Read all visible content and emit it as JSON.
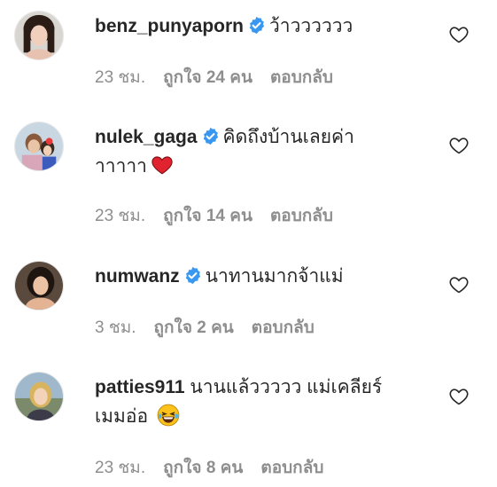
{
  "comments": [
    {
      "username": "benz_punyaporn",
      "verified": true,
      "text": "ว้าวววววว",
      "time": "23 ชม.",
      "likes": "ถูกใจ 24 คน",
      "reply": "ตอบกลับ"
    },
    {
      "username": "nulek_gaga",
      "verified": true,
      "text": "คิดถึงบ้านเลยค่าาาาาา",
      "text_line1": "คิดถึงบ้านเลยค่า",
      "text_line2": "าาาาา",
      "emoji": "red-heart-emoji",
      "time": "23 ชม.",
      "likes": "ถูกใจ 14 คน",
      "reply": "ตอบกลับ"
    },
    {
      "username": "numwanz",
      "verified": true,
      "text": "นาทานมากจ้าแม่",
      "time": "3 ชม.",
      "likes": "ถูกใจ 2 คน",
      "reply": "ตอบกลับ"
    },
    {
      "username": "patties911",
      "verified": false,
      "text_line1": "นานแล้ววววว แม่เคลียร์",
      "text_line2": "เมมอ่อ",
      "emoji": "laughing-tears-emoji",
      "time": "23 ชม.",
      "likes": "ถูกใจ 8 คน",
      "reply": "ตอบกลับ"
    }
  ],
  "colors": {
    "text": "#262626",
    "meta": "#8e8e8e",
    "verified": "#3897f0",
    "heart_outline": "#262626"
  }
}
